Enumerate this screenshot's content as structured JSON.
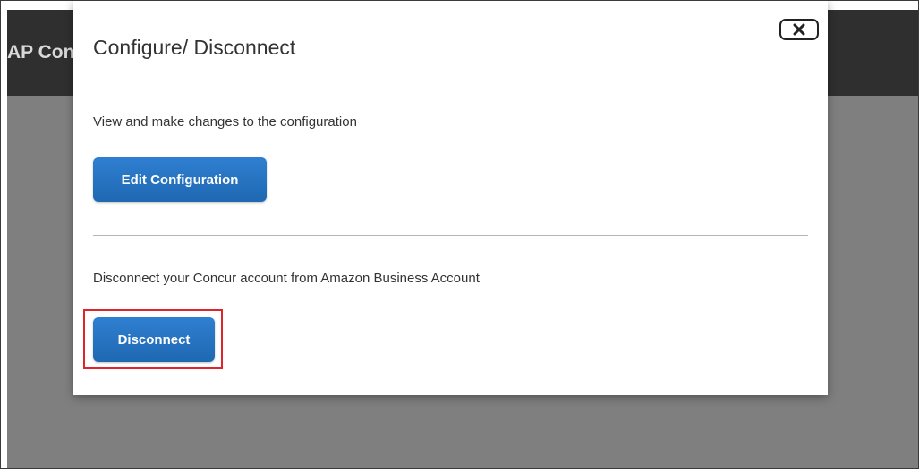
{
  "app": {
    "title": "AP Concur"
  },
  "modal": {
    "title": "Configure/ Disconnect",
    "close_icon": "close-icon",
    "configure_text": "View and make changes to the configuration",
    "edit_button_label": "Edit Configuration",
    "disconnect_text": "Disconnect your Concur account from Amazon Business Account",
    "disconnect_button_label": "Disconnect"
  },
  "colors": {
    "button_blue": "#1f6fbf",
    "highlight_red": "#e0242b",
    "header_dark": "#2f2f2f",
    "backdrop_gray": "#7f7f7f"
  }
}
